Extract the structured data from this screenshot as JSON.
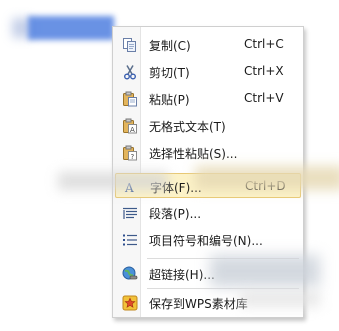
{
  "context_menu": {
    "items": [
      {
        "label": "复制(C)",
        "shortcut": "Ctrl+C",
        "icon": "copy-icon"
      },
      {
        "label": "剪切(T)",
        "shortcut": "Ctrl+X",
        "icon": "scissors-icon"
      },
      {
        "label": "粘贴(P)",
        "shortcut": "Ctrl+V",
        "icon": "paste-icon"
      },
      {
        "label": "无格式文本(T)",
        "shortcut": "",
        "icon": "paste-plain-text-icon"
      },
      {
        "label": "选择性粘贴(S)...",
        "shortcut": "",
        "icon": "paste-special-icon"
      },
      {
        "label": "字体(F)...",
        "shortcut": "Ctrl+D",
        "icon": "font-icon"
      },
      {
        "label": "段落(P)...",
        "shortcut": "",
        "icon": "paragraph-icon"
      },
      {
        "label": "项目符号和编号(N)...",
        "shortcut": "",
        "icon": "bullets-numbering-icon"
      },
      {
        "label": "超链接(H)...",
        "shortcut": "",
        "icon": "hyperlink-icon"
      },
      {
        "label": "保存到WPS素材库",
        "shortcut": "",
        "icon": "star-save-icon"
      }
    ]
  },
  "colors": {
    "highlight_bg": "#fdf3c8",
    "highlight_border": "#e8c873",
    "menu_border": "#cfcfcf",
    "selection_blue": "#4f7fe0"
  }
}
